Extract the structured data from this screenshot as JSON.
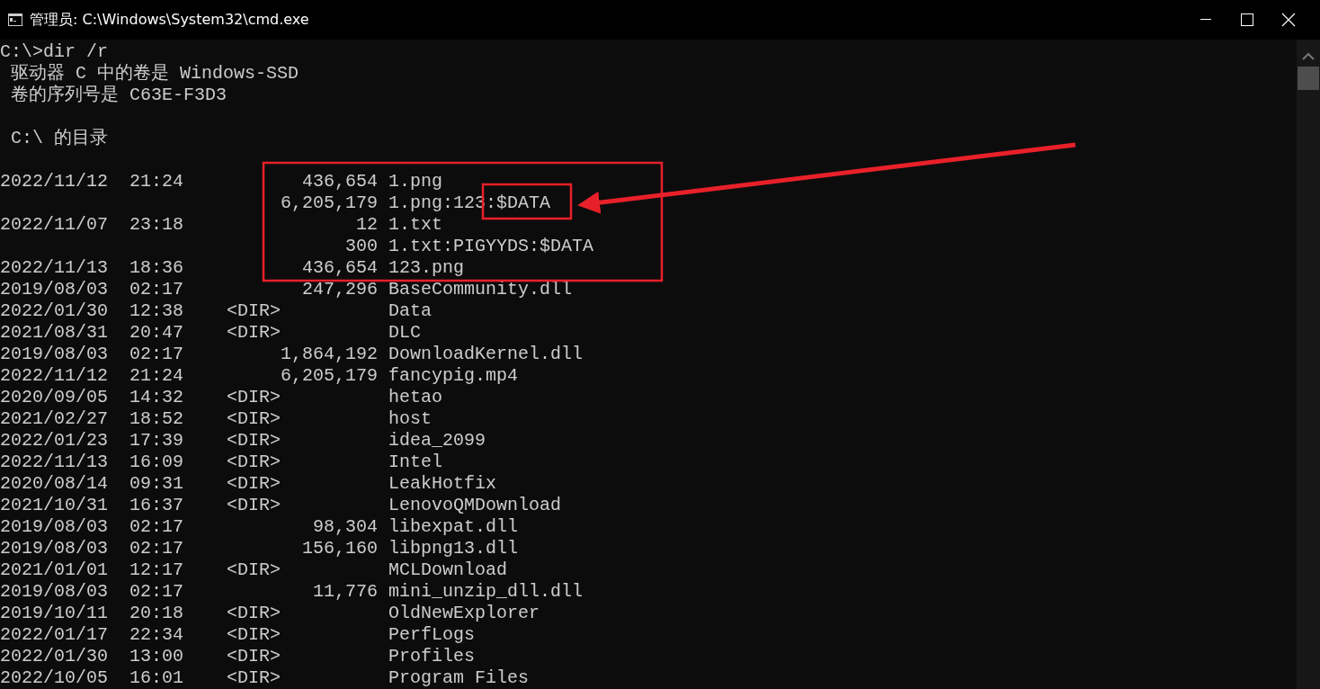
{
  "window": {
    "title": "管理员: C:\\Windows\\System32\\cmd.exe"
  },
  "console": {
    "lines": [
      {
        "kind": "text",
        "text": "C:\\>dir /r"
      },
      {
        "kind": "text",
        "text": " 驱动器 C 中的卷是 Windows-SSD"
      },
      {
        "kind": "text",
        "text": " 卷的序列号是 C63E-F3D3"
      },
      {
        "kind": "blank"
      },
      {
        "kind": "text",
        "text": " C:\\ 的目录"
      },
      {
        "kind": "blank"
      },
      {
        "kind": "file",
        "date": "2022/11/12",
        "time": "21:24",
        "size": "436,654",
        "name": "1.png"
      },
      {
        "kind": "stream",
        "size": "6,205,179",
        "name": "1.png:123:$DATA"
      },
      {
        "kind": "file",
        "date": "2022/11/07",
        "time": "23:18",
        "size": "12",
        "name": "1.txt"
      },
      {
        "kind": "stream",
        "size": "300",
        "name": "1.txt:PIGYYDS:$DATA"
      },
      {
        "kind": "file",
        "date": "2022/11/13",
        "time": "18:36",
        "size": "436,654",
        "name": "123.png"
      },
      {
        "kind": "file",
        "date": "2019/08/03",
        "time": "02:17",
        "size": "247,296",
        "name": "BaseCommunity.dll"
      },
      {
        "kind": "dir",
        "date": "2022/01/30",
        "time": "12:38",
        "tag": "<DIR>",
        "name": "Data"
      },
      {
        "kind": "dir",
        "date": "2021/08/31",
        "time": "20:47",
        "tag": "<DIR>",
        "name": "DLC"
      },
      {
        "kind": "file",
        "date": "2019/08/03",
        "time": "02:17",
        "size": "1,864,192",
        "name": "DownloadKernel.dll"
      },
      {
        "kind": "file",
        "date": "2022/11/12",
        "time": "21:24",
        "size": "6,205,179",
        "name": "fancypig.mp4"
      },
      {
        "kind": "dir",
        "date": "2020/09/05",
        "time": "14:32",
        "tag": "<DIR>",
        "name": "hetao"
      },
      {
        "kind": "dir",
        "date": "2021/02/27",
        "time": "18:52",
        "tag": "<DIR>",
        "name": "host"
      },
      {
        "kind": "dir",
        "date": "2022/01/23",
        "time": "17:39",
        "tag": "<DIR>",
        "name": "idea_2099"
      },
      {
        "kind": "dir",
        "date": "2022/11/13",
        "time": "16:09",
        "tag": "<DIR>",
        "name": "Intel"
      },
      {
        "kind": "dir",
        "date": "2020/08/14",
        "time": "09:31",
        "tag": "<DIR>",
        "name": "LeakHotfix"
      },
      {
        "kind": "dir",
        "date": "2021/10/31",
        "time": "16:37",
        "tag": "<DIR>",
        "name": "LenovoQMDownload"
      },
      {
        "kind": "file",
        "date": "2019/08/03",
        "time": "02:17",
        "size": "98,304",
        "name": "libexpat.dll"
      },
      {
        "kind": "file",
        "date": "2019/08/03",
        "time": "02:17",
        "size": "156,160",
        "name": "libpng13.dll"
      },
      {
        "kind": "dir",
        "date": "2021/01/01",
        "time": "12:17",
        "tag": "<DIR>",
        "name": "MCLDownload"
      },
      {
        "kind": "file",
        "date": "2019/08/03",
        "time": "02:17",
        "size": "11,776",
        "name": "mini_unzip_dll.dll"
      },
      {
        "kind": "dir",
        "date": "2019/10/11",
        "time": "20:18",
        "tag": "<DIR>",
        "name": "OldNewExplorer"
      },
      {
        "kind": "dir",
        "date": "2022/01/17",
        "time": "22:34",
        "tag": "<DIR>",
        "name": "PerfLogs"
      },
      {
        "kind": "dir",
        "date": "2022/01/30",
        "time": "13:00",
        "tag": "<DIR>",
        "name": "Profiles"
      },
      {
        "kind": "dir",
        "date": "2022/10/05",
        "time": "16:01",
        "tag": "<DIR>",
        "name": "Program Files"
      }
    ]
  }
}
